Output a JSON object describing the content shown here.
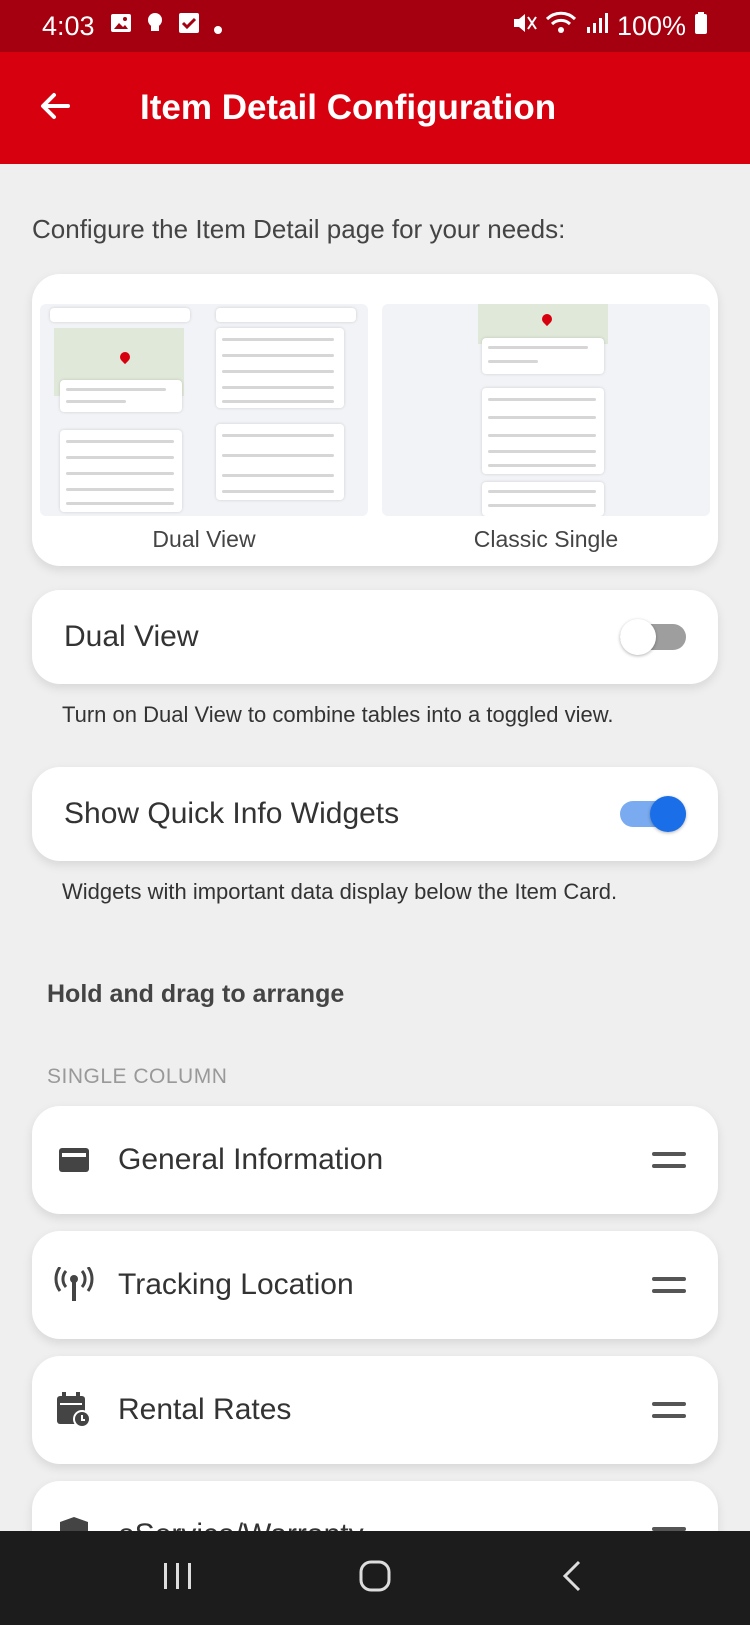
{
  "status_bar": {
    "time": "4:03",
    "battery": "100%"
  },
  "app_bar": {
    "title": "Item Detail Configuration"
  },
  "intro": "Configure the Item Detail page for your needs:",
  "previews": [
    {
      "label": "Dual View"
    },
    {
      "label": "Classic Single"
    }
  ],
  "settings": {
    "dual_view": {
      "label": "Dual View",
      "enabled": false,
      "helper": "Turn on Dual View to combine tables into a toggled view."
    },
    "quick_info": {
      "label": "Show Quick Info Widgets",
      "enabled": true,
      "helper": "Widgets with important data display below the Item Card."
    }
  },
  "arrange": {
    "title": "Hold and drag to arrange",
    "subtitle": "SINGLE COLUMN",
    "items": [
      {
        "label": "General Information",
        "icon": "card-icon"
      },
      {
        "label": "Tracking Location",
        "icon": "antenna-icon"
      },
      {
        "label": "Rental Rates",
        "icon": "calendar-clock-icon"
      },
      {
        "label": "eService/Warranty",
        "icon": "shield-icon"
      }
    ]
  },
  "colors": {
    "brand": "#d7000f",
    "status_bar": "#a5000f",
    "toggle_on": "#1a6ee8"
  }
}
